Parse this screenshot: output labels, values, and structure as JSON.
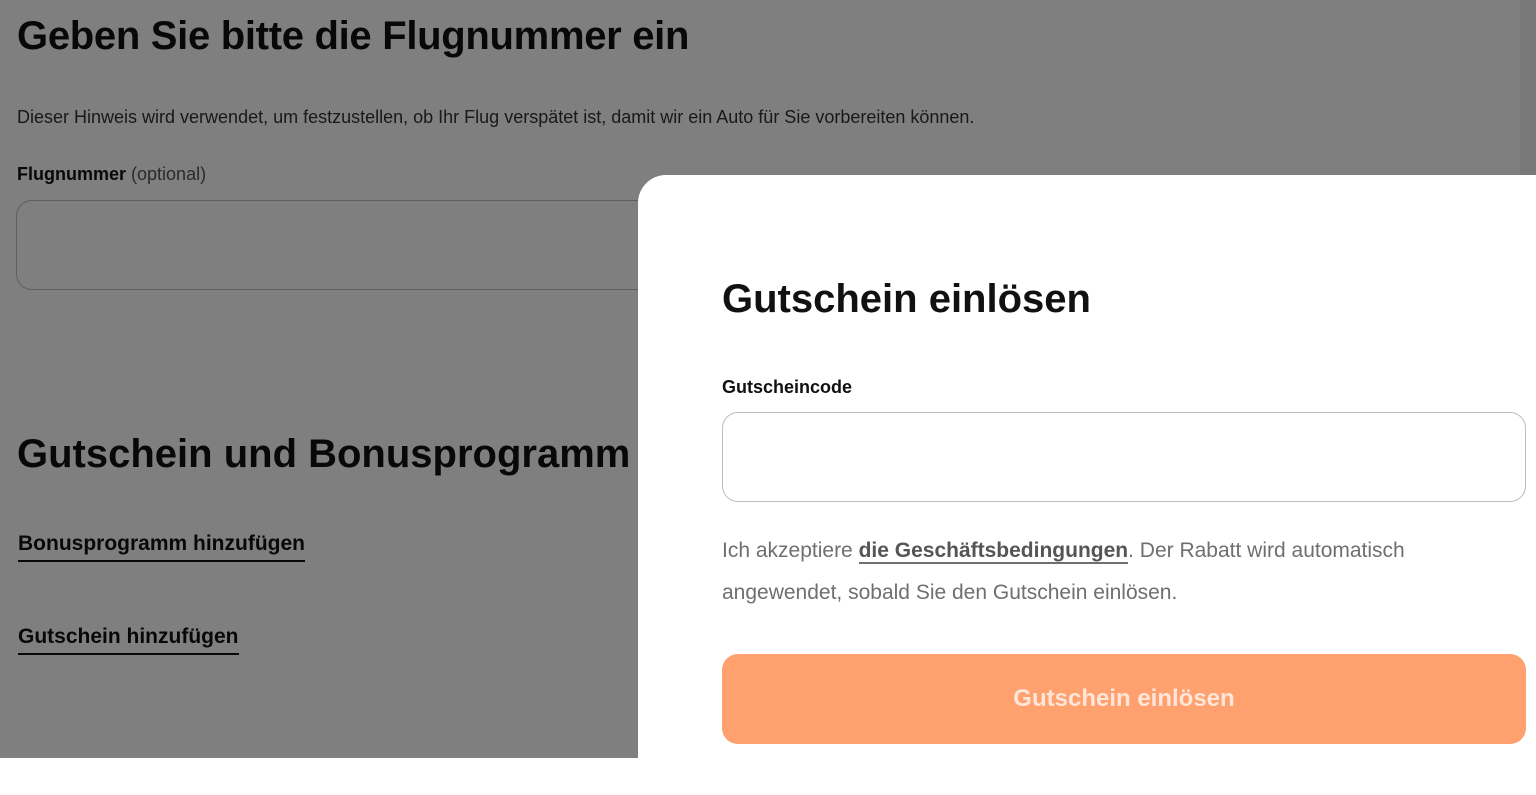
{
  "flight": {
    "title": "Geben Sie bitte die Flugnummer ein",
    "hint": "Dieser Hinweis wird verwendet, um festzustellen, ob Ihr Flug verspätet ist, damit wir ein Auto für Sie vorbereiten können.",
    "field_label": "Flugnummer",
    "field_optional": "(optional)",
    "field_value": ""
  },
  "bonus": {
    "title": "Gutschein und Bonusprogramm",
    "add_bonus_link": "Bonusprogramm hinzufügen",
    "add_voucher_link": "Gutschein hinzufügen"
  },
  "voucher_drawer": {
    "title": "Gutschein einlösen",
    "code_label": "Gutscheincode",
    "code_value": "",
    "terms_prefix": "Ich akzeptiere ",
    "terms_link": "die Geschäftsbedingungen",
    "terms_suffix": ". Der Rabatt wird automatisch angewendet, sobald Sie den Gutschein einlösen.",
    "redeem_button": "Gutschein einlösen"
  },
  "colors": {
    "overlay": "rgba(0,0,0,0.5)",
    "button_background": "#ffa06f",
    "button_text": "#ffe6d8",
    "text_primary": "#111111",
    "text_muted": "#6f6f6f"
  }
}
